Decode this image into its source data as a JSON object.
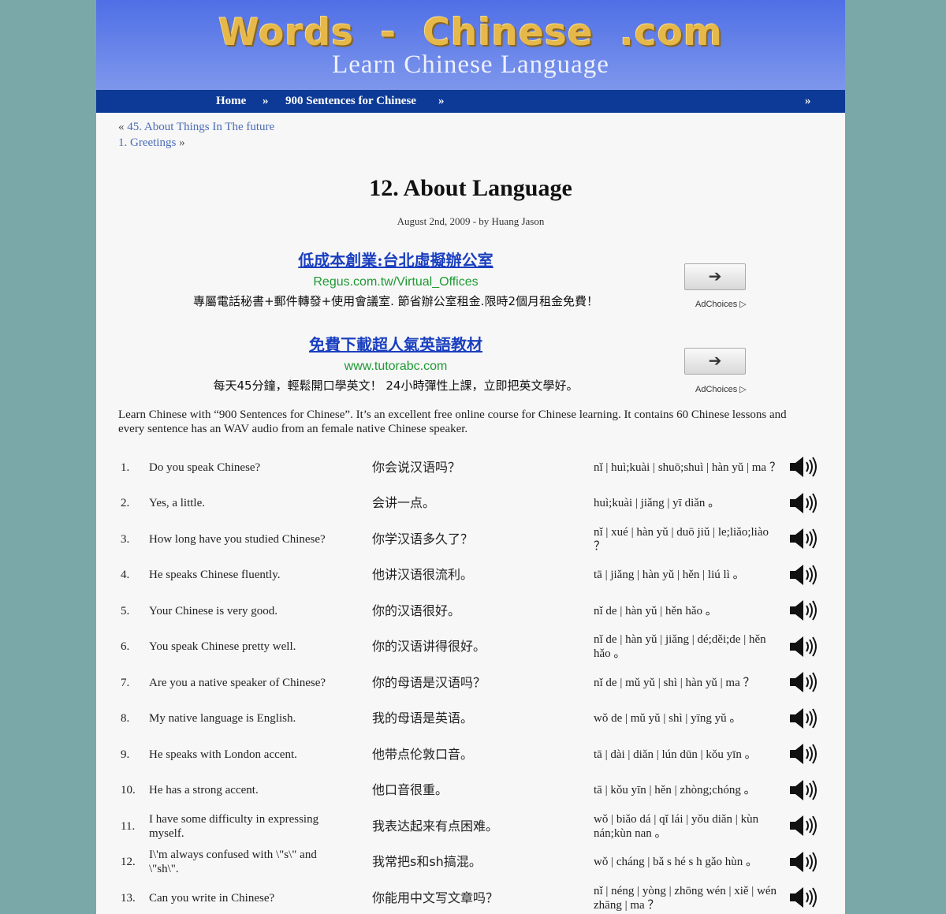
{
  "site": {
    "logo": "Words - Chinese .com",
    "tagline": "Learn Chinese Language"
  },
  "nav": {
    "home": "Home",
    "sep1": "»",
    "category": "900 Sentences for Chinese",
    "sep2": "»",
    "sep3": "»"
  },
  "prevnext": {
    "prev_marker": "«",
    "prev_link": "45. About Things In The future",
    "next_link": "1. Greetings",
    "next_marker": "»"
  },
  "post": {
    "title": "12. About Language",
    "meta": "August 2nd, 2009 - by Huang Jason",
    "intro": "Learn Chinese with “900 Sentences for Chinese”. It’s an excellent free online course for Chinese learning. It contains 60 Chinese lessons and every sentence has an WAV audio from an female native Chinese speaker."
  },
  "ads": [
    {
      "title": "低成本創業:台北虛擬辦公室",
      "url": "Regus.com.tw/Virtual_Offices",
      "desc": "專屬電話秘書+郵件轉發+使用會議室. 節省辦公室租金.限時2個月租金免費！",
      "button": "➔",
      "choices": "AdChoices ▷"
    },
    {
      "title": "免費下載超人氣英語教材",
      "url": "www.tutorabc.com",
      "desc": "每天45分鐘，輕鬆開口學英文！ 24小時彈性上課，立即把英文學好。",
      "button": "➔",
      "choices": "AdChoices ▷"
    }
  ],
  "lessons": [
    {
      "num": "1.",
      "en": "Do you speak Chinese?",
      "cn": "你会说汉语吗？",
      "py": "nǐ | huì;kuài | shuō;shuì | hàn yǔ | ma ？"
    },
    {
      "num": "2.",
      "en": "Yes, a little.",
      "cn": "会讲一点。",
      "py": "huì;kuài | jiǎng | yī diǎn 。"
    },
    {
      "num": "3.",
      "en": "How long have you studied Chinese?",
      "cn": "你学汉语多久了？",
      "py": "nǐ | xué | hàn yǔ | duō jiǔ | le;liǎo;liào ？"
    },
    {
      "num": "4.",
      "en": "He speaks Chinese fluently.",
      "cn": "他讲汉语很流利。",
      "py": "tā | jiǎng | hàn yǔ | hěn | liú lì 。"
    },
    {
      "num": "5.",
      "en": "Your Chinese is very good.",
      "cn": "你的汉语很好。",
      "py": "nǐ de | hàn yǔ | hěn hǎo 。"
    },
    {
      "num": "6.",
      "en": "You speak Chinese pretty well.",
      "cn": "你的汉语讲得很好。",
      "py": "nǐ de | hàn yǔ | jiǎng | dé;děi;de | hěn hǎo 。"
    },
    {
      "num": "7.",
      "en": "Are you a native speaker of Chinese?",
      "cn": "你的母语是汉语吗？",
      "py": "nǐ de | mǔ yǔ | shì | hàn yǔ | ma ？"
    },
    {
      "num": "8.",
      "en": "My native language is English.",
      "cn": "我的母语是英语。",
      "py": "wǒ de | mǔ yǔ | shì | yīng yǔ 。"
    },
    {
      "num": "9.",
      "en": "He speaks with London accent.",
      "cn": "他带点伦敦口音。",
      "py": "tā | dài | diǎn | lún dūn | kǒu yīn 。"
    },
    {
      "num": "10.",
      "en": "He has a strong accent.",
      "cn": "他口音很重。",
      "py": "tā | kǒu yīn | hěn | zhòng;chóng 。"
    },
    {
      "num": "11.",
      "en": "I have some difficulty in expressing myself.",
      "cn": "我表达起来有点困难。",
      "py": "wǒ | biǎo dá | qǐ lái | yǒu diǎn | kùn nán;kùn nan 。"
    },
    {
      "num": "12.",
      "en": "I\\'m always confused with \\\"s\\\" and \\\"sh\\\".",
      "cn": "我常把s和sh搞混。",
      "py": "wǒ | cháng | bǎ s hé s h gǎo hùn 。"
    },
    {
      "num": "13.",
      "en": "Can you write in Chinese?",
      "cn": "你能用中文写文章吗？",
      "py": "nǐ | néng | yòng | zhōng wén | xiě | wén zhāng | ma ？"
    }
  ]
}
